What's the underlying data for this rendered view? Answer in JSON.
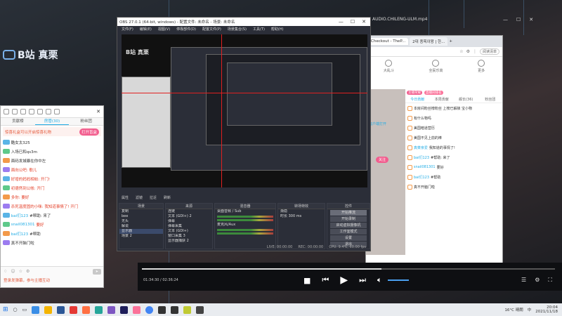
{
  "desktop": {
    "watermark": "B站 真栗"
  },
  "chat_window": {
    "tabs": [
      "贡献榜",
      "房管(30)",
      "粉丝团"
    ],
    "notice": "惊喜礼盒可以开启惊喜礼物",
    "notice_button": "打开盲盒",
    "messages": [
      {
        "badge": "",
        "user": "",
        "text": "酷女太325"
      },
      {
        "badge": "",
        "user": "",
        "text": "入场已和qs3m"
      },
      {
        "badge": "",
        "user": "",
        "text": "面码发城暴在你中左"
      },
      {
        "badge": "",
        "user": "",
        "text": "面向公吧: 歌儿"
      },
      {
        "badge": "",
        "user": "",
        "text": "好增的妈妈相帖: 开门!"
      },
      {
        "badge": "",
        "user": "",
        "text": "初德然到公帐: 开门"
      },
      {
        "badge": "",
        "user": "",
        "text": "多你: 要好"
      },
      {
        "badge": "",
        "user": "",
        "text": "杀死温度固的小咪: 我知道事情了! 开门"
      },
      {
        "badge": "",
        "user": "bai们123",
        "text": "#帮助: 来了"
      },
      {
        "badge": "",
        "user": "snail081301",
        "text": "要好"
      },
      {
        "badge": "",
        "user": "bai们123",
        "text": "#帮助"
      },
      {
        "badge": "",
        "user": "",
        "text": "真不开脑门啦"
      }
    ],
    "input_hint": "登录发弹幕，参与主播互动"
  },
  "obs": {
    "title": "OBS 27.0.1 (64-bit, windows) - 配置文件: 未命名 - 场景: 未命名",
    "menu": [
      "文件(F)",
      "编辑(E)",
      "视图(V)",
      "停靠部件(D)",
      "配置文件(P)",
      "场景集合(S)",
      "工具(T)",
      "帮助(H)"
    ],
    "toolbar": [
      "属性",
      "滤镜",
      "拉近",
      "刷新"
    ],
    "scenes_header": "场景",
    "scenes": [
      "复制",
      "bee",
      "无头",
      "解说",
      "显示器",
      "场景 2"
    ],
    "sources_header": "来源",
    "sources": [
      "连链",
      "文本 (GDI+) 2",
      "弹幕",
      "弹幕采集",
      "文本 (GDI+)",
      "窗口采集 3",
      "显示器捕获 2"
    ],
    "mixer_header": "混音器",
    "mixer_tracks": [
      "桌面音频 / Sub",
      "麦克风/Aux"
    ],
    "transition_header": "转场特效",
    "transition_type": "渐隐",
    "transition_label": "时长",
    "transition_duration": "300 ms",
    "controls_header": "控件",
    "controls": [
      "开始推流",
      "开始录制",
      "启动虚拟摄像机",
      "工作室模式",
      "设置",
      "退出"
    ],
    "status": [
      "LIVE: 00:00:00",
      "REC: 00:00:00",
      "CPU: 9.4%, 60.00 fps"
    ]
  },
  "browser": {
    "tabs": [
      "Checkout - TheP...",
      "2대 종목이왕 | 한..."
    ],
    "sync_button": "阅读清单",
    "nav": [
      "大乱斗",
      "全民乐高",
      "更多"
    ],
    "bottom_tabs": [
      "今日贡献",
      "本周贡献",
      "舰长(36)",
      "粉丝团"
    ],
    "badges": [
      "主播荣耀",
      "直播间排名",
      "客户端打开",
      "关注"
    ],
    "messages": [
      {
        "user": "",
        "text": "本房间粉丝榜粉丝 上榜已解锁 宝小物"
      },
      {
        "user": "",
        "text": "有什么物吗"
      },
      {
        "user": "",
        "text": "美国暗道营历"
      },
      {
        "user": "",
        "text": "美国不见上前的棒"
      },
      {
        "user": "真菜亲爱",
        "text": "我知道的事情了!"
      },
      {
        "user": "bai们123",
        "text": "#帮助: 来了"
      },
      {
        "user": "snail081301",
        "text": "要好"
      },
      {
        "user": "bai们123",
        "text": "#帮助"
      },
      {
        "user": "",
        "text": "真不开脑门啦"
      }
    ]
  },
  "player": {
    "file_title": "AUDIO.CHILENG-ULM.mp4",
    "current_time": "01:34:30",
    "total_time": "02:36:24",
    "progress": 0.58
  },
  "taskbar": {
    "weather": "16°C 晴朗",
    "time": "20:04",
    "date": "2021/11/18",
    "ime": "中"
  }
}
